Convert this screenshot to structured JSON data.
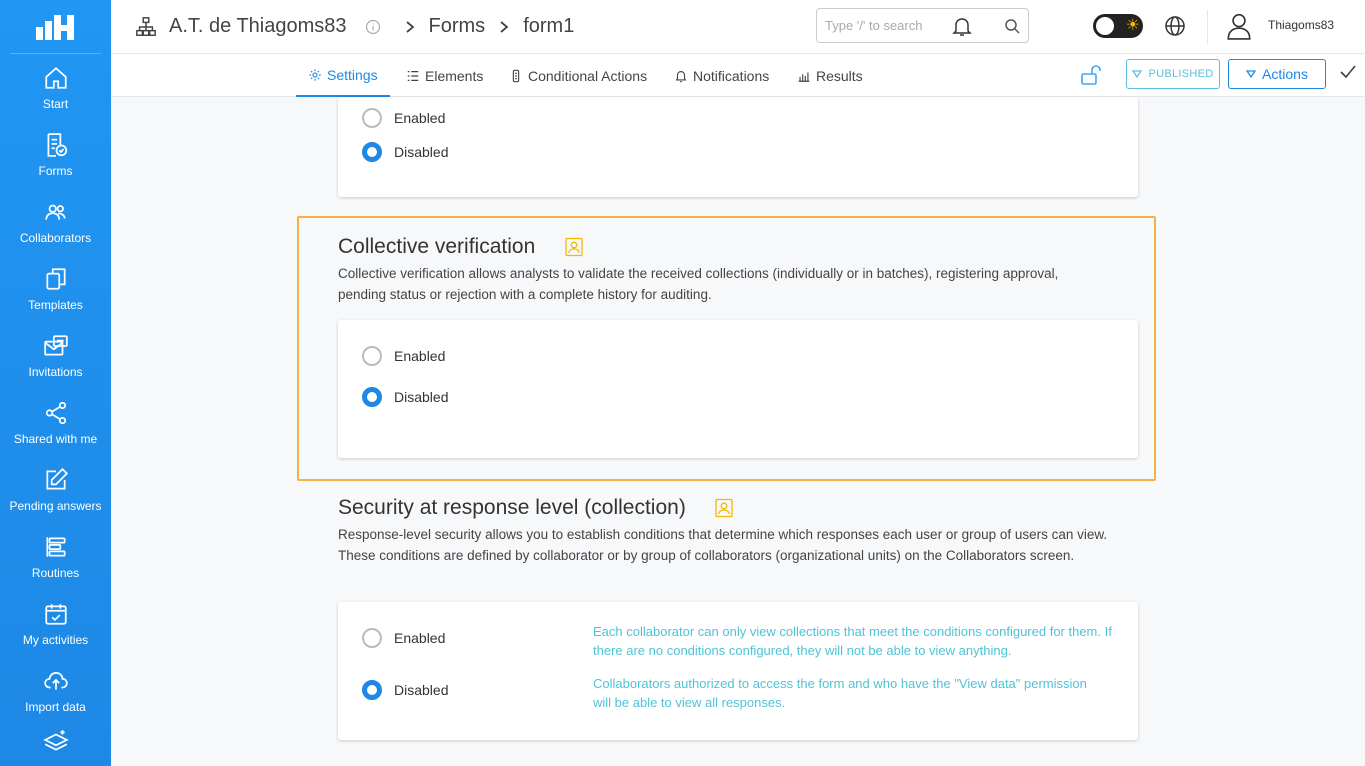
{
  "sidebar": {
    "items": [
      {
        "label": "Start",
        "icon": "home-icon"
      },
      {
        "label": "Forms",
        "icon": "forms-icon"
      },
      {
        "label": "Collaborators",
        "icon": "collaborators-icon"
      },
      {
        "label": "Templates",
        "icon": "templates-icon"
      },
      {
        "label": "Invitations",
        "icon": "invitations-icon"
      },
      {
        "label": "Shared with me",
        "icon": "share-icon"
      },
      {
        "label": "Pending answers",
        "icon": "edit-icon"
      },
      {
        "label": "Routines",
        "icon": "routines-icon"
      },
      {
        "label": "My activities",
        "icon": "calendar-check-icon"
      },
      {
        "label": "Import data",
        "icon": "cloud-upload-icon"
      },
      {
        "label": "",
        "icon": "layers-icon"
      }
    ]
  },
  "header": {
    "org_name": "A.T. de Thiagoms83",
    "crumb_forms": "Forms",
    "crumb_form": "form1",
    "search_placeholder": "Type '/' to search",
    "username": "Thiagoms83"
  },
  "tabs": [
    {
      "label": "Settings",
      "icon": "gear-icon",
      "active": true
    },
    {
      "label": "Elements",
      "icon": "list-icon",
      "active": false
    },
    {
      "label": "Conditional Actions",
      "icon": "condition-icon",
      "active": false
    },
    {
      "label": "Notifications",
      "icon": "bell-icon",
      "active": false
    },
    {
      "label": "Results",
      "icon": "bar-chart-icon",
      "active": false
    }
  ],
  "toolbar": {
    "published_label": "PUBLISHED",
    "actions_label": "Actions"
  },
  "sections": {
    "top": {
      "enabled_label": "Enabled",
      "disabled_label": "Disabled",
      "selected": "Disabled"
    },
    "collective": {
      "title": "Collective verification",
      "description": "Collective verification allows analysts to validate the received collections (individually or in batches), registering approval, pending status or rejection with a complete history for auditing.",
      "enabled_label": "Enabled",
      "disabled_label": "Disabled",
      "selected": "Disabled"
    },
    "security": {
      "title": "Security at response level (collection)",
      "description": "Response-level security allows you to establish conditions that determine which responses each user or group of users can view. These conditions are defined by collaborator or by group of collaborators (organizational units) on the Collaborators screen.",
      "enabled_label": "Enabled",
      "disabled_label": "Disabled",
      "selected": "Disabled",
      "enabled_hint": "Each collaborator can only view collections that meet the conditions configured for them. If there are no conditions configured, they will not be able to view anything.",
      "disabled_hint": "Collaborators authorized to access the form and who have the \"View data\" permission will be able to view all responses."
    }
  },
  "colors": {
    "primary": "#1e88e5",
    "sidebar": "#2196f3",
    "highlight": "#f5b04a",
    "hint": "#4fc3d7"
  }
}
